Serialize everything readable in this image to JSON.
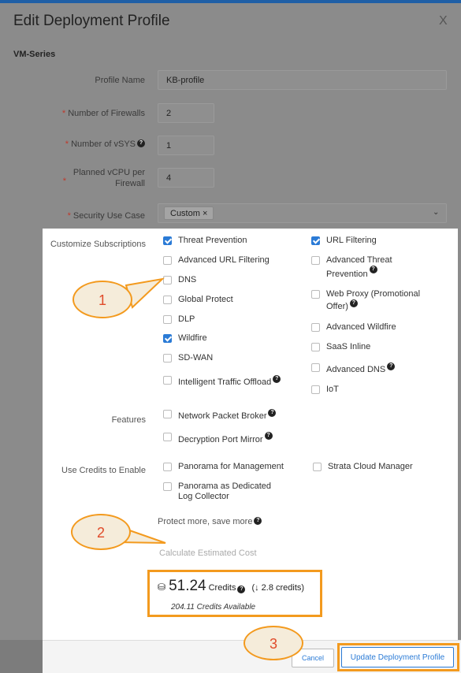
{
  "header": {
    "title": "Edit Deployment Profile",
    "close": "X"
  },
  "section": "VM-Series",
  "fields": {
    "profile_name": {
      "label": "Profile Name",
      "value": "KB-profile"
    },
    "num_firewalls": {
      "label": "Number of Firewalls",
      "value": "2"
    },
    "num_vsys": {
      "label": "Number of vSYS",
      "value": "1"
    },
    "vcpu_line1": "Planned vCPU per",
    "vcpu_line2": "Firewall",
    "vcpu_value": "4",
    "security_use_case": {
      "label": "Security Use Case",
      "chip": "Custom",
      "chip_remove": "×"
    }
  },
  "subscriptions": {
    "label": "Customize Subscriptions",
    "left": [
      {
        "label": "Threat Prevention",
        "checked": true
      },
      {
        "label": "Advanced URL Filtering",
        "checked": false
      },
      {
        "label": "DNS",
        "checked": false
      },
      {
        "label": "Global Protect",
        "checked": false
      },
      {
        "label": "DLP",
        "checked": false
      },
      {
        "label": "Wildfire",
        "checked": true
      },
      {
        "label": "SD-WAN",
        "checked": false
      },
      {
        "label": "Intelligent Traffic Offload",
        "checked": false
      }
    ],
    "right": [
      {
        "label": "URL Filtering",
        "checked": true
      },
      {
        "label": "Advanced Threat",
        "label2": "Prevention",
        "checked": false
      },
      {
        "label": "Web Proxy (Promotional",
        "label2": "Offer)",
        "checked": false
      },
      {
        "label": "Advanced Wildfire",
        "checked": false
      },
      {
        "label": "SaaS Inline",
        "checked": false
      },
      {
        "label": "Advanced DNS",
        "checked": false
      },
      {
        "label": "IoT",
        "checked": false
      }
    ]
  },
  "features": {
    "label": "Features",
    "items": [
      {
        "label": "Network Packet Broker",
        "checked": false
      },
      {
        "label": "Decryption Port Mirror",
        "checked": false
      }
    ]
  },
  "credits_enable": {
    "label": "Use Credits to Enable",
    "items": [
      {
        "label": "Panorama for Management",
        "checked": false
      },
      {
        "label": "Panorama as Dedicated",
        "label2": "Log Collector",
        "checked": false
      },
      {
        "label": "Strata Cloud Manager",
        "checked": false
      }
    ]
  },
  "protect_more": "Protect more, save more",
  "calculate": "Calculate Estimated Cost",
  "credits": {
    "amount": "51.24",
    "unit": "Credits",
    "delta": "(↓ 2.8 credits)",
    "available": "204.11 Credits Available"
  },
  "footer": {
    "cancel": "Cancel",
    "update": "Update Deployment Profile"
  },
  "callouts": {
    "one": "1",
    "two": "2",
    "three": "3"
  },
  "help": "?"
}
